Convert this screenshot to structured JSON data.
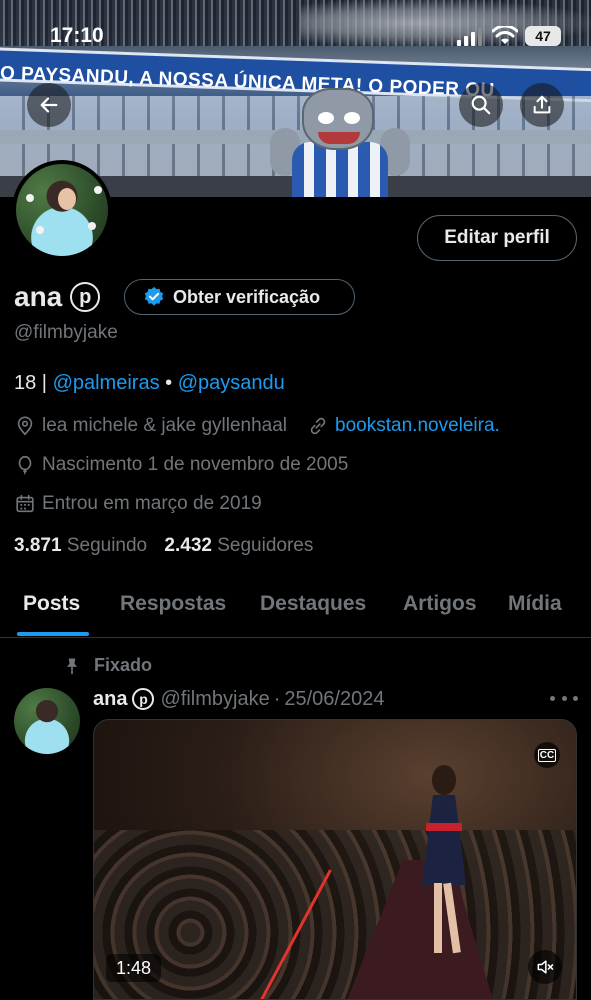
{
  "status_bar": {
    "time": "17:10",
    "battery": "47"
  },
  "banner": {
    "text": "O PAYSANDU, A NOSSA ÚNICA META!   O PODER  QU"
  },
  "profile": {
    "name": "ana",
    "badge_letter": "p",
    "verify_label": "Obter verificação",
    "handle": "@filmbyjake",
    "edit_label": "Editar perfil",
    "bio_prefix": "18 | ",
    "bio_link1": "@palmeiras",
    "bio_sep": " • ",
    "bio_link2": "@paysandu",
    "location": "lea michele & jake gyllenhaal",
    "website": "bookstan.noveleira.",
    "birthday": "Nascimento 1 de novembro de 2005",
    "joined": "Entrou em março de 2019",
    "following_count": "3.871",
    "following_label": "Seguindo",
    "followers_count": "2.432",
    "followers_label": "Seguidores"
  },
  "tabs": [
    "Posts",
    "Respostas",
    "Destaques",
    "Artigos",
    "Mídia"
  ],
  "post": {
    "pinned_label": "Fixado",
    "author": "ana",
    "badge_letter": "p",
    "handle": "@filmbyjake",
    "date": "25/06/2024",
    "cc_label": "CC",
    "duration": "1:48"
  },
  "colors": {
    "accent": "#1d9bf0",
    "background": "#000000",
    "muted": "#71767b",
    "text": "#e7e9ea"
  }
}
